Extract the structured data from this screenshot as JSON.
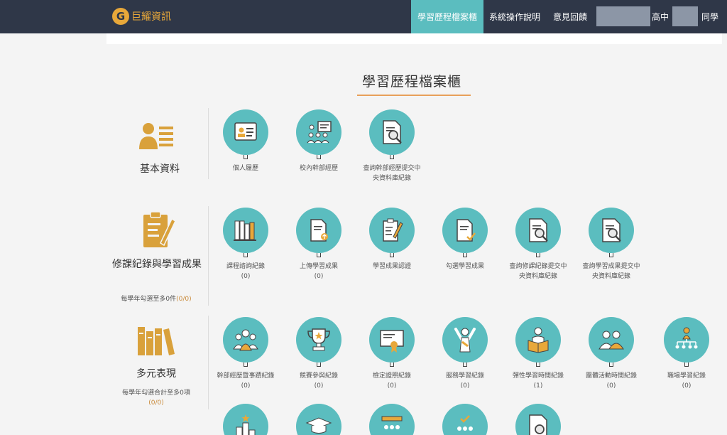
{
  "navbar": {
    "logo_letter": "G",
    "logo_text": "巨耀資訊",
    "active_tab": "學習歷程檔案櫃",
    "guide": "系統操作說明",
    "feedback": "意見回饋",
    "school_suffix": "高中",
    "student_suffix": "同學"
  },
  "page_title": "學習歷程檔案櫃",
  "sections": {
    "basic": {
      "label": "基本資料",
      "items": [
        {
          "label": "個人履歷",
          "icon": "id-card-icon"
        },
        {
          "label": "校內幹部經歷",
          "icon": "group-board-icon"
        },
        {
          "label": "查詢幹部經歷提交中央資料庫紀錄",
          "icon": "document-search-icon"
        }
      ]
    },
    "courses": {
      "label": "修課紀錄與學習成果",
      "note_prefix": "每學年勾選至多0件",
      "note_count": "(0/0)",
      "items": [
        {
          "label": "課程諮詢紀錄",
          "count": "(0)",
          "icon": "books-icon"
        },
        {
          "label": "上傳學習成果",
          "count": "(0)",
          "icon": "upload-document-icon"
        },
        {
          "label": "學習成果認證",
          "count": "",
          "icon": "clipboard-pen-icon"
        },
        {
          "label": "勾選學習成果",
          "count": "",
          "icon": "document-check-icon"
        },
        {
          "label": "查詢修課紀錄提交中央資料庫紀錄",
          "count": "",
          "icon": "document-search-icon"
        },
        {
          "label": "查詢學習成果提交中央資料庫紀錄",
          "count": "",
          "icon": "document-search-icon"
        }
      ]
    },
    "diverse": {
      "label": "多元表現",
      "note_prefix": "每學年勾選合計至多0項",
      "note_count": "(0/0)",
      "items": [
        {
          "label": "幹部經歷暨事蹟紀錄",
          "count": "(0)",
          "icon": "team-icon"
        },
        {
          "label": "競賽參與紀錄",
          "count": "(0)",
          "icon": "trophy-icon"
        },
        {
          "label": "檢定證照紀錄",
          "count": "(0)",
          "icon": "certificate-icon"
        },
        {
          "label": "服務學習紀錄",
          "count": "(0)",
          "icon": "cheering-person-icon"
        },
        {
          "label": "彈性學習時間紀錄",
          "count": "(1)",
          "icon": "reading-person-icon"
        },
        {
          "label": "團體活動時間紀錄",
          "count": "(0)",
          "icon": "group-icon"
        },
        {
          "label": "職場學習紀錄",
          "count": "(0)",
          "icon": "org-chart-icon"
        }
      ]
    }
  }
}
